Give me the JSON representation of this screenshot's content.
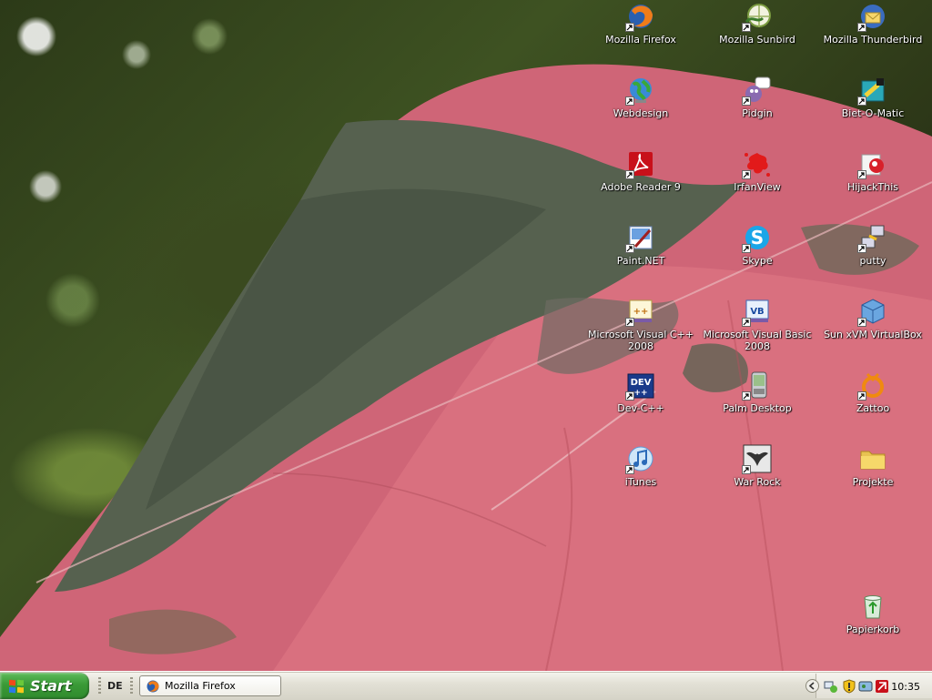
{
  "desktop": {
    "icons": [
      {
        "label": "Mozilla Firefox",
        "icon": "firefox-icon"
      },
      {
        "label": "Mozilla Sunbird",
        "icon": "sunbird-icon"
      },
      {
        "label": "Mozilla Thunderbird",
        "icon": "thunderbird-icon"
      },
      {
        "label": "Webdesign",
        "icon": "globe-icon"
      },
      {
        "label": "Pidgin",
        "icon": "pidgin-icon"
      },
      {
        "label": "Biet-O-Matic",
        "icon": "biet-o-matic-icon"
      },
      {
        "label": "Adobe Reader 9",
        "icon": "adobe-reader-icon"
      },
      {
        "label": "IrfanView",
        "icon": "irfanview-icon"
      },
      {
        "label": "HijackThis",
        "icon": "hijackthis-icon"
      },
      {
        "label": "Paint.NET",
        "icon": "paintnet-icon"
      },
      {
        "label": "Skype",
        "icon": "skype-icon"
      },
      {
        "label": "putty",
        "icon": "putty-icon"
      },
      {
        "label": "Microsoft Visual C++ 2008",
        "icon": "visual-cpp-icon"
      },
      {
        "label": "Microsoft Visual Basic 2008",
        "icon": "visual-basic-icon"
      },
      {
        "label": "Sun xVM VirtualBox",
        "icon": "virtualbox-icon"
      },
      {
        "label": "Dev-C++",
        "icon": "dev-cpp-icon"
      },
      {
        "label": "Palm Desktop",
        "icon": "palm-desktop-icon"
      },
      {
        "label": "Zattoo",
        "icon": "zattoo-icon"
      },
      {
        "label": "iTunes",
        "icon": "itunes-icon"
      },
      {
        "label": "War Rock",
        "icon": "war-rock-icon"
      },
      {
        "label": "Projekte",
        "icon": "folder-icon"
      },
      {
        "label": "Papierkorb",
        "icon": "recycle-bin-icon"
      }
    ]
  },
  "taskbar": {
    "start_label": "Start",
    "language": "DE",
    "tasks": [
      {
        "label": "Mozilla Firefox",
        "icon": "firefox-icon"
      }
    ],
    "clock": "10:35",
    "tray_icons": [
      "network-icon",
      "security-shield-icon",
      "hardware-icon",
      "adobe-updater-icon"
    ]
  },
  "colors": {
    "start_green": "#3a9a37",
    "taskbar_bg": "#e3e1d6",
    "leaf_pink": "#d66a7e",
    "leaf_dark": "#55614f"
  }
}
